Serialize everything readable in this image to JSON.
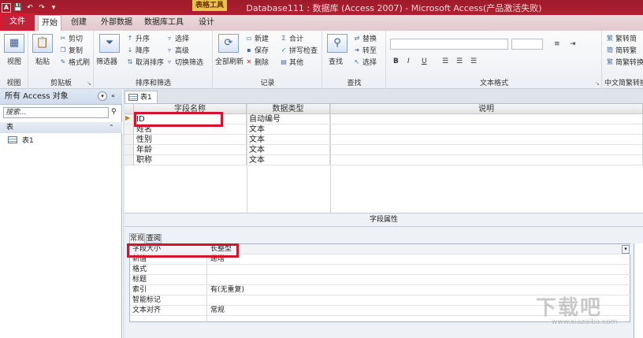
{
  "title_bar": {
    "window_title": "Database111 : 数据库 (Access 2007) - Microsoft Access(产品激活失败)",
    "contextual_label": "表格工具",
    "app_icon": "A",
    "qat": [
      {
        "icon": "save-icon",
        "glyph": "💾"
      },
      {
        "icon": "undo-icon",
        "glyph": "↶"
      },
      {
        "icon": "redo-icon",
        "glyph": "↷"
      },
      {
        "icon": "customize-icon",
        "glyph": "▾"
      }
    ]
  },
  "tabs": {
    "file": "文件",
    "home": "开始",
    "create": "创建",
    "external": "外部数据",
    "dbtools": "数据库工具",
    "design": "设计"
  },
  "ribbon": {
    "view": {
      "button": "视图",
      "label": "视图"
    },
    "clipboard": {
      "paste": "粘贴",
      "cut": "剪切",
      "copy": "复制",
      "format_painter": "格式刷",
      "label": "剪贴板"
    },
    "sort_filter": {
      "filter": "筛选器",
      "ascending": "升序",
      "descending": "降序",
      "remove_sort": "取消排序",
      "selection": "选择",
      "advanced": "高级",
      "toggle_filter": "切换筛选",
      "label": "排序和筛选"
    },
    "records": {
      "refresh": "全部刷新",
      "new": "新建",
      "save": "保存",
      "delete": "删除",
      "totals": "合计",
      "spelling": "拼写检查",
      "more": "其他",
      "label": "记录"
    },
    "find": {
      "find": "查找",
      "replace": "替换",
      "goto": "转至",
      "select": "选择",
      "label": "查找"
    },
    "text_format": {
      "bold": "B",
      "italic": "I",
      "underline": "U",
      "label": "文本格式"
    },
    "chinese_conv": {
      "t2s": "繁转简",
      "s2t": "简转繁",
      "conv": "简繁转换",
      "label": "中文简繁转换"
    }
  },
  "nav_pane": {
    "header": "所有 Access 对象",
    "search_placeholder": "搜索...",
    "category": "表",
    "items": [
      {
        "label": "表1"
      }
    ]
  },
  "document": {
    "tab_label": "表1",
    "columns": {
      "field_name": "字段名称",
      "data_type": "数据类型",
      "description": "说明"
    },
    "rows": [
      {
        "field": "ID",
        "type": "自动编号"
      },
      {
        "field": "姓名",
        "type": "文本"
      },
      {
        "field": "性别",
        "type": "文本"
      },
      {
        "field": "年龄",
        "type": "文本"
      },
      {
        "field": "职称",
        "type": "文本"
      }
    ],
    "field_properties_label": "字段属性",
    "prop_tabs": {
      "general": "常规",
      "lookup": "查阅"
    },
    "properties": [
      {
        "label": "字段大小",
        "value": "长整型"
      },
      {
        "label": "新值",
        "value": "递增"
      },
      {
        "label": "格式",
        "value": ""
      },
      {
        "label": "标题",
        "value": ""
      },
      {
        "label": "索引",
        "value": "有(无重复)"
      },
      {
        "label": "智能标记",
        "value": ""
      },
      {
        "label": "文本对齐",
        "value": "常规"
      }
    ]
  },
  "watermark": {
    "text": "下载吧",
    "url": "www.xiazaiba.com"
  },
  "colors": {
    "title_bar": "#a81d2e",
    "file_tab": "#c1243a",
    "highlight_box": "#d4142a"
  }
}
